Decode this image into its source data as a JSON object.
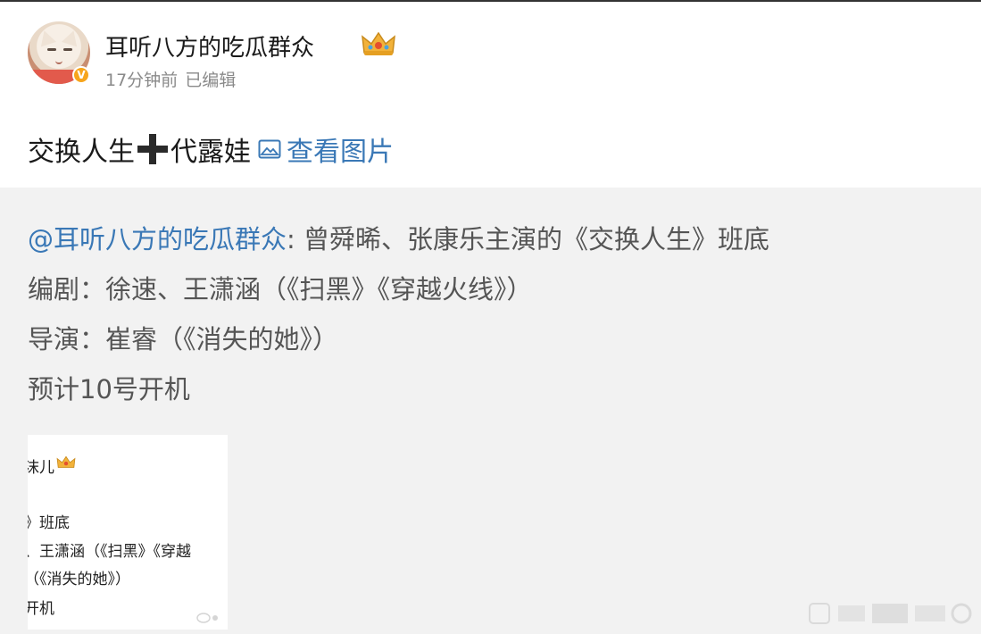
{
  "post": {
    "username": "耳听八方的吃瓜群众",
    "time": "17分钟前",
    "edited": "已编辑",
    "text_part1": "交换人生",
    "text_part2": "代露娃",
    "view_pictures": "查看图片"
  },
  "repost": {
    "mention": "@耳听八方的吃瓜群众",
    "line1_rest": ": 曾舜晞、张康乐主演的《交换人生》班底",
    "line2": "编剧：徐速、王潇涵（《扫黑》《穿越火线》）",
    "line3": "导演：崔睿（《消失的她》）",
    "line4": "预计10号开机"
  },
  "thumbnail": {
    "line1": "沫儿",
    "line2": "》班底",
    "line3": "、王潇涵（《扫黑》《穿越",
    "line4": "（《消失的她》）",
    "line5": "开机"
  },
  "icons": [
    "crown-icon",
    "verified-icon",
    "plus-icon",
    "image-icon",
    "watermark"
  ],
  "colors": {
    "link": "#3a78b6",
    "repost_bg": "#f2f2f2",
    "badge": "#f7a51c"
  }
}
